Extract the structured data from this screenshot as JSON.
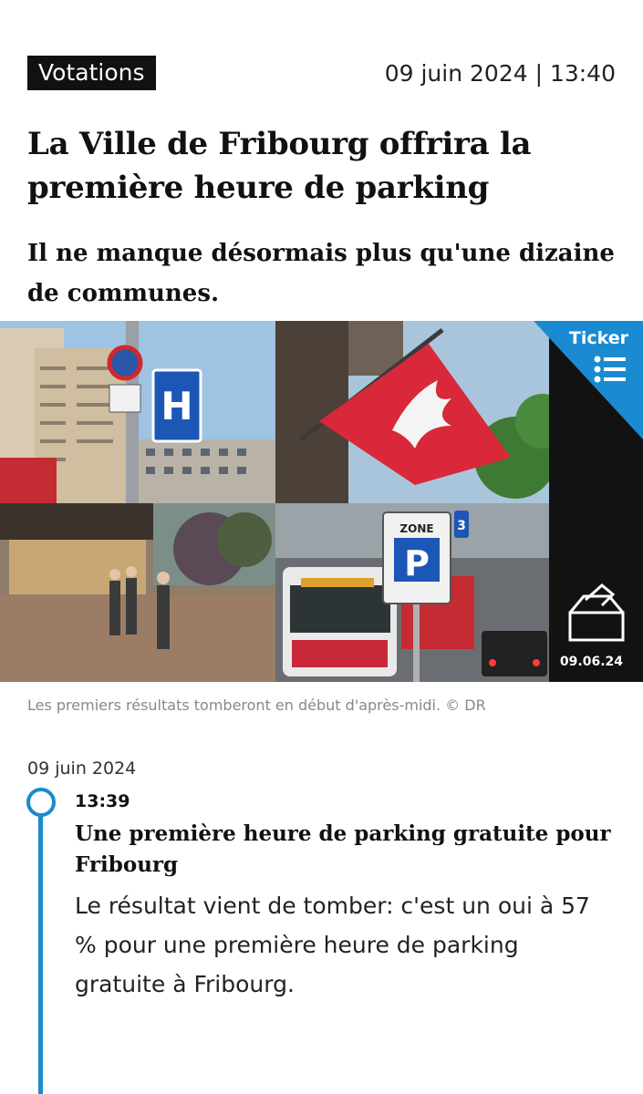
{
  "article": {
    "category": "Votations",
    "datetime": "09 juin 2024 | 13:40",
    "title": "La Ville de Fribourg offrira la première heure de parking",
    "lead": "Il ne manque désormais plus qu'une dizaine de communes.",
    "image": {
      "ticker_label": "Ticker",
      "ballot_date": "09.06.24",
      "sign_letters": [
        "H",
        "P"
      ],
      "sign_texts": [
        "ZONE",
        "3"
      ],
      "icons": [
        "list-icon",
        "ballot-box-icon",
        "fribourg-flag",
        "hospital-sign",
        "parking-sign"
      ],
      "colors": {
        "ticker_blue": "#1a8bd0",
        "flag_red": "#d8283a"
      }
    },
    "caption": "Les premiers résultats tomberont en début d'après-midi. © DR"
  },
  "feed": {
    "date": "09 juin 2024",
    "entries": [
      {
        "time": "13:39",
        "title": "Une première heure de parking gratuite pour Fribourg",
        "body": "Le résultat vient de tomber: c'est un oui à 57 % pour une première heure de parking gratuite à Fribourg."
      }
    ],
    "accent_color": "#1a8bd0"
  }
}
